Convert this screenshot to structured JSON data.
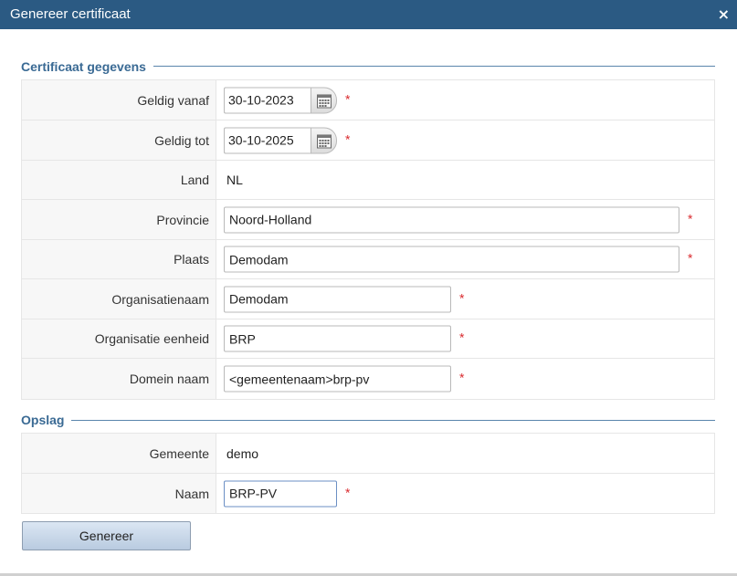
{
  "dialog": {
    "title": "Genereer certificaat",
    "close_label": "×"
  },
  "sections": {
    "certificaat": {
      "legend": "Certificaat gegevens",
      "geldig_vanaf": {
        "label": "Geldig vanaf",
        "value": "30-10-2023"
      },
      "geldig_tot": {
        "label": "Geldig tot",
        "value": "30-10-2025"
      },
      "land": {
        "label": "Land",
        "value": "NL"
      },
      "provincie": {
        "label": "Provincie",
        "value": "Noord-Holland"
      },
      "plaats": {
        "label": "Plaats",
        "value": "Demodam"
      },
      "organisatienaam": {
        "label": "Organisatienaam",
        "value": "Demodam"
      },
      "organisatie_eenheid": {
        "label": "Organisatie eenheid",
        "value": "BRP"
      },
      "domein_naam": {
        "label": "Domein naam",
        "value": "<gemeentenaam>brp-pv"
      }
    },
    "opslag": {
      "legend": "Opslag",
      "gemeente": {
        "label": "Gemeente",
        "value": "demo"
      },
      "naam": {
        "label": "Naam",
        "value": "BRP-PV"
      }
    }
  },
  "required_marker": "*",
  "buttons": {
    "generate_label": "Genereer"
  },
  "colors": {
    "titlebar": "#2b5a83",
    "legend": "#3a6a94",
    "required": "#d9282c"
  },
  "icons": {
    "calendar": "calendar-icon",
    "close": "close-icon"
  }
}
